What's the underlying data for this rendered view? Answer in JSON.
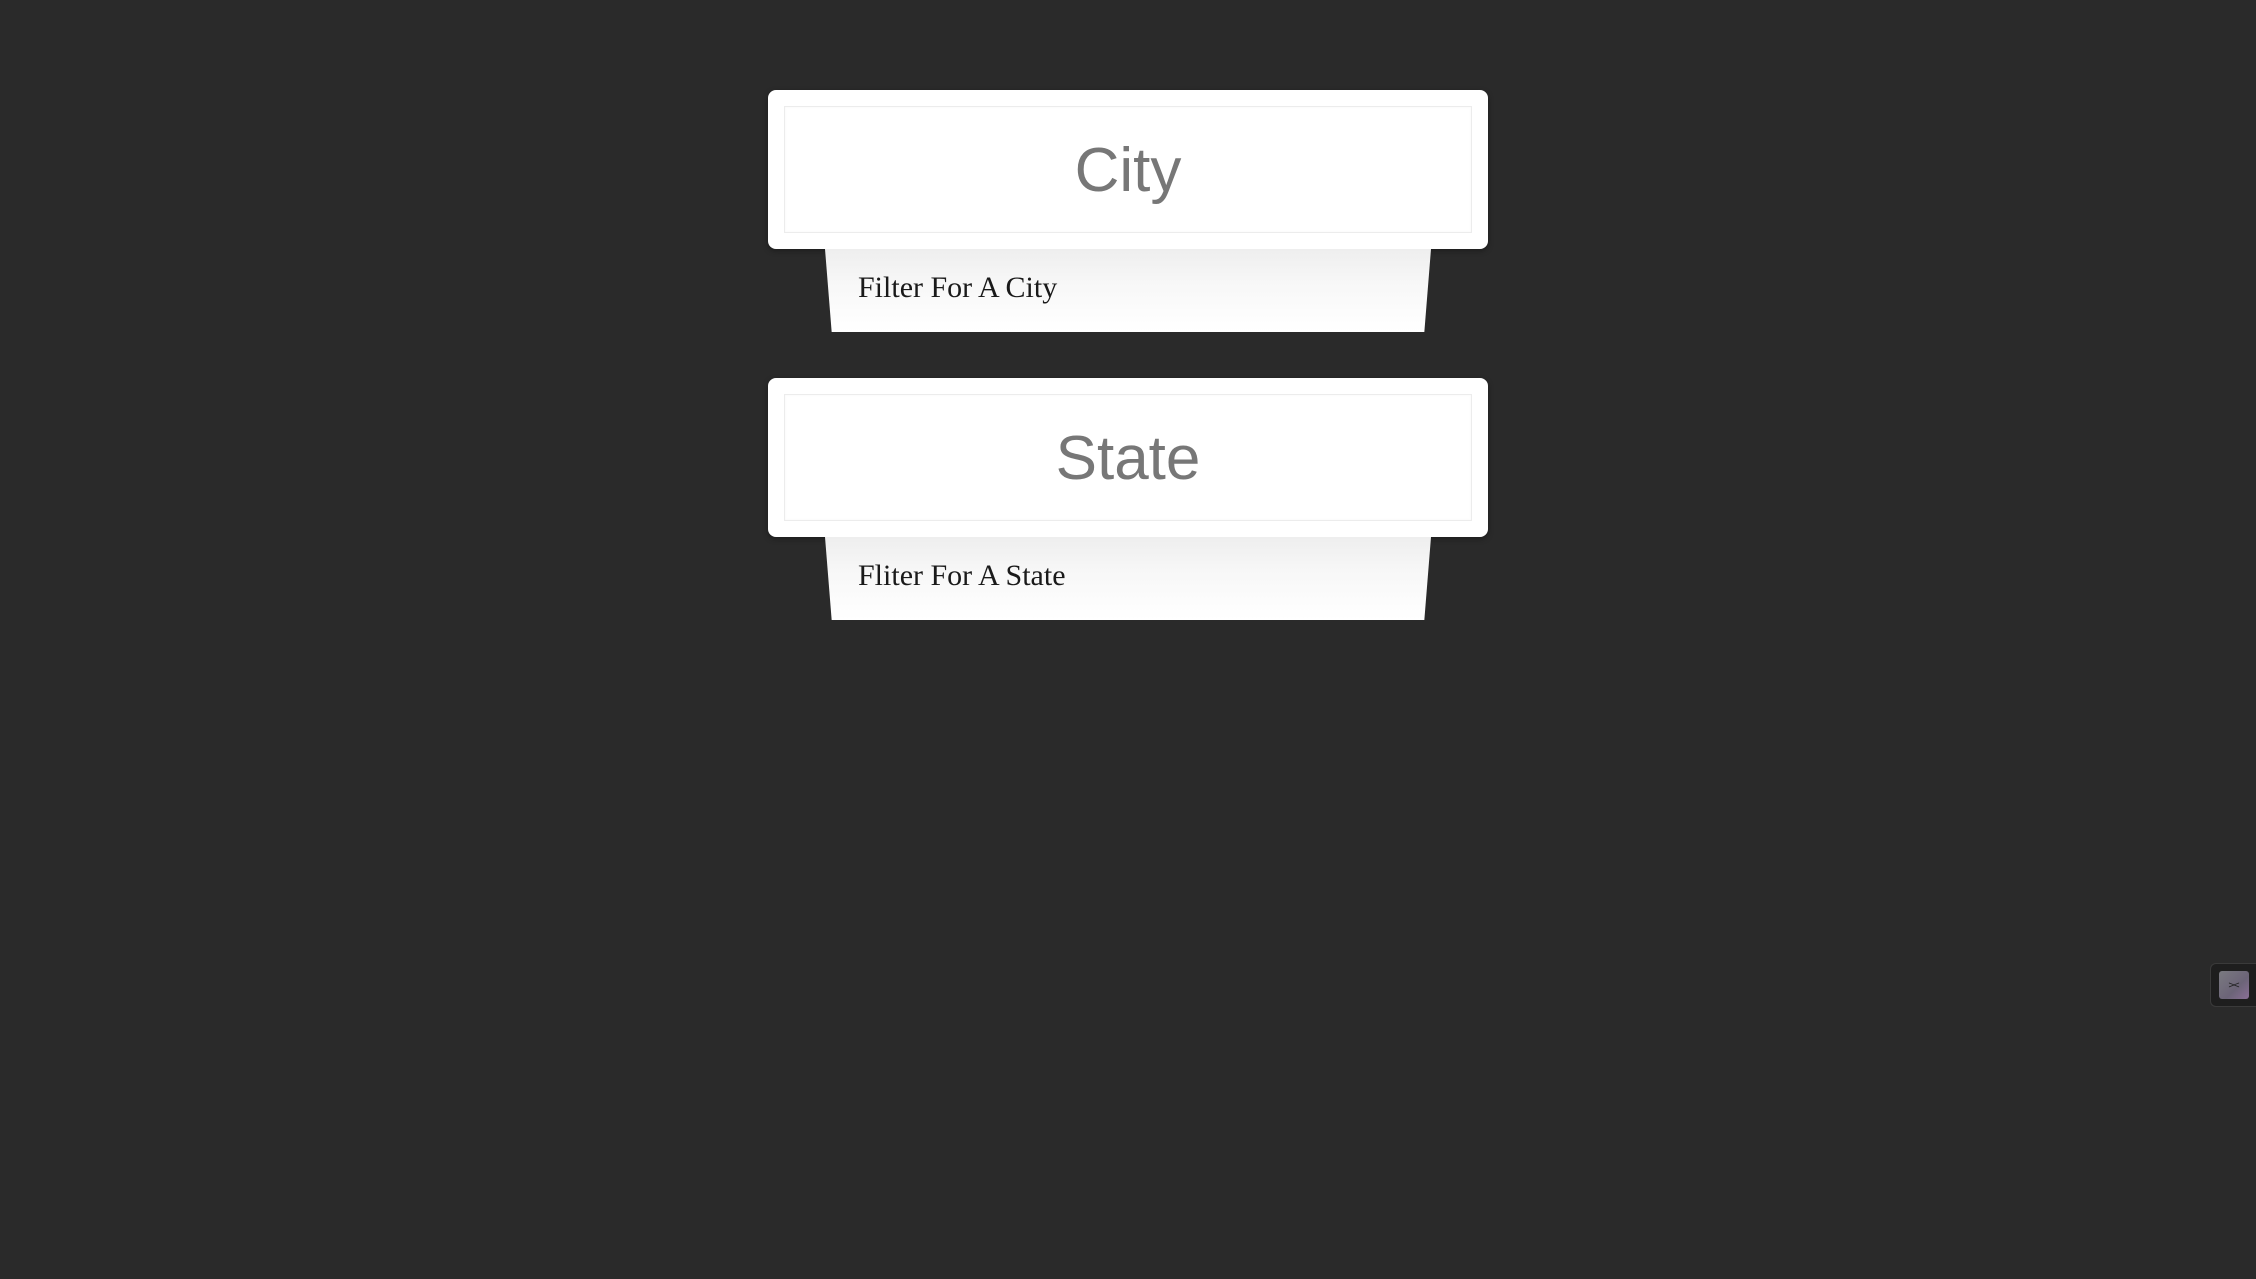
{
  "filters": [
    {
      "title": "City",
      "tab_label": "Filter For A City"
    },
    {
      "title": "State",
      "tab_label": "Fliter For A State"
    }
  ],
  "widget": {
    "icon": "devtools-face-icon",
    "glyph": "><"
  },
  "colors": {
    "background": "#2a2a2a",
    "card": "#ffffff",
    "title_text": "#777777",
    "tab_text": "#1a1a1a"
  }
}
